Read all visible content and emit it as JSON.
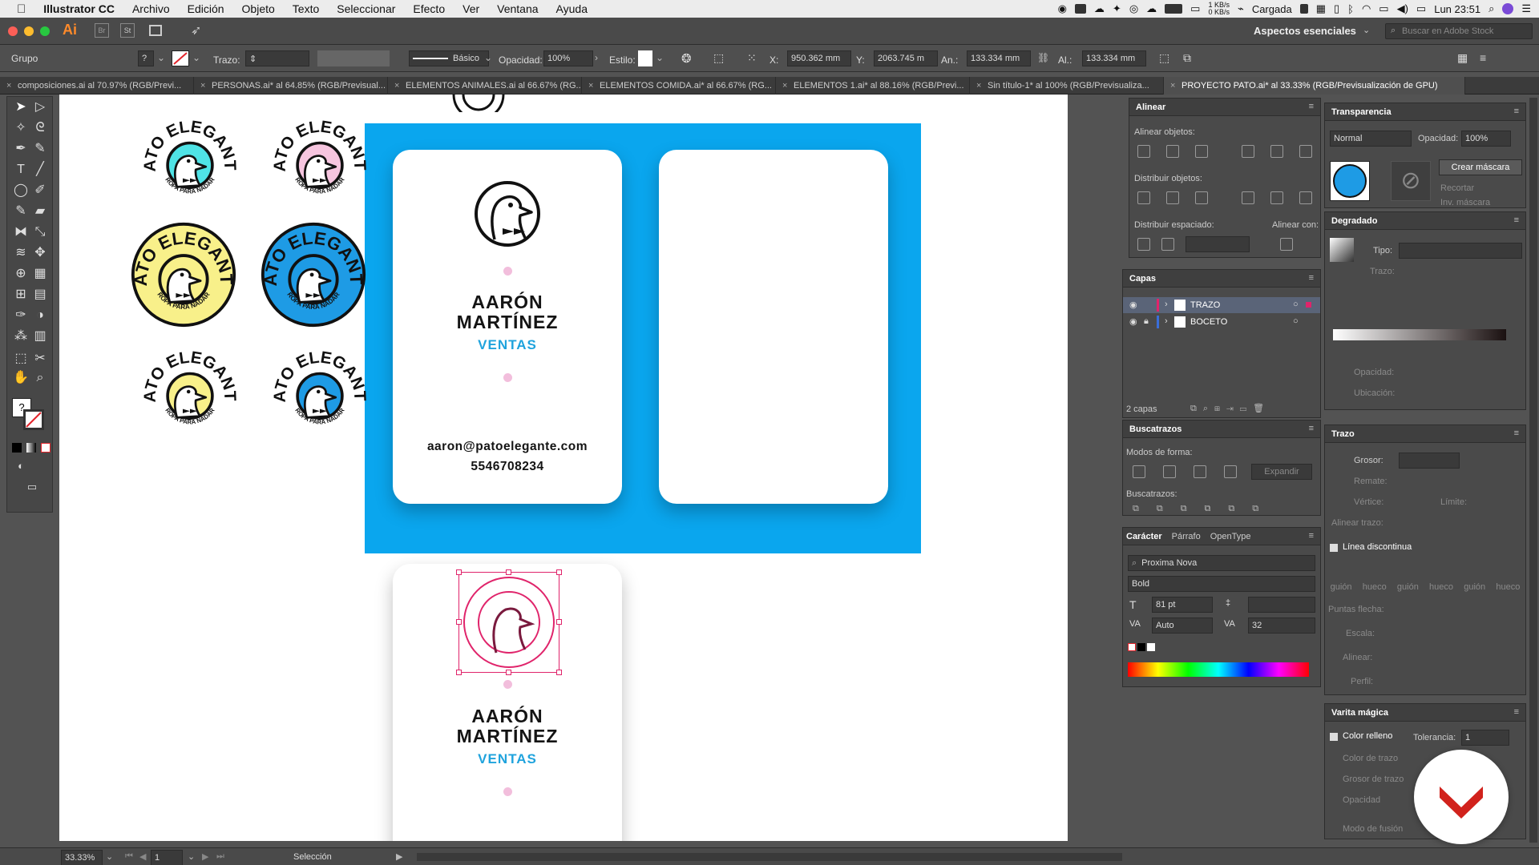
{
  "menubar": {
    "app_name": "Illustrator CC",
    "items": [
      "Archivo",
      "Edición",
      "Objeto",
      "Texto",
      "Seleccionar",
      "Efecto",
      "Ver",
      "Ventana",
      "Ayuda"
    ],
    "net_up": "1 KB/s",
    "net_down": "0 KB/s",
    "battery_label": "Cargada",
    "clock": "Lun 23:51"
  },
  "appbar": {
    "logo": "Ai",
    "workspace": "Aspectos esenciales",
    "search_placeholder": "Buscar en Adobe Stock"
  },
  "control": {
    "selection_type": "Grupo",
    "stroke_label": "Trazo:",
    "brush_label": "Básico",
    "opacity_label": "Opacidad:",
    "opacity_value": "100%",
    "style_label": "Estilo:",
    "x_label": "X:",
    "x_value": "950.362 mm",
    "y_label": "Y:",
    "y_value": "2063.745 m",
    "w_label": "An.:",
    "w_value": "133.334 mm",
    "h_label": "Al.:",
    "h_value": "133.334 mm"
  },
  "tabs": [
    "composiciones.ai al 70.97% (RGB/Previ...",
    "PERSONAS.ai* al 64.85% (RGB/Previsual...",
    "ELEMENTOS ANIMALES.ai al 66.67% (RG...",
    "ELEMENTOS COMIDA.ai* al 66.67% (RG...",
    "ELEMENTOS 1.ai* al 88.16% (RGB/Previ...",
    "Sin título-1* al 100% (RGB/Previsualiza...",
    "PROYECTO PATO.ai* al 33.33% (RGB/Previsualización de GPU)"
  ],
  "logos": {
    "top_text": "PATO ELEGANTE",
    "bottom_text": "ROPA PARA NADAR",
    "colors": [
      "#4fe3e6",
      "#f6c5df",
      "#f8f08a",
      "#1e9be5",
      "#f8f08a",
      "#1e9be5"
    ]
  },
  "card": {
    "name_line1": "AARÓN",
    "name_line2": "MARTÍNEZ",
    "role": "VENTAS",
    "email": "aaron@patoelegante.com",
    "phone": "5546708234",
    "bg_color": "#0aa6ee",
    "accent": "#1fa3dd",
    "dot_color": "#f2bedc"
  },
  "panels": {
    "align": {
      "title": "Alinear",
      "align_objects": "Alinear objetos:",
      "distribute_objects": "Distribuir objetos:",
      "distribute_spacing": "Distribuir espaciado:",
      "align_to": "Alinear con:"
    },
    "layers": {
      "title": "Capas",
      "items": [
        "TRAZO",
        "BOCETO"
      ],
      "count": "2 capas"
    },
    "pathfinder": {
      "title": "Buscatrazos",
      "shape_modes": "Modos de forma:",
      "expand": "Expandir",
      "pathfinders": "Buscatrazos:"
    },
    "character": {
      "tabs": [
        "Carácter",
        "Párrafo",
        "OpenType"
      ],
      "font": "Proxima Nova",
      "style": "Bold",
      "size": "81 pt",
      "leading": "Auto",
      "tracking": "32"
    },
    "transparency": {
      "title": "Transparencia",
      "mode": "Normal",
      "opacity_label": "Opacidad:",
      "opacity": "100%",
      "make_mask": "Crear máscara",
      "clip": "Recortar",
      "invert": "Inv. máscara"
    },
    "gradient": {
      "title": "Degradado",
      "type_label": "Tipo:",
      "stroke_label": "Trazo:",
      "opacity_label": "Opacidad:",
      "location_label": "Ubicación:"
    },
    "stroke": {
      "title": "Trazo",
      "weight_label": "Grosor:",
      "cap_label": "Remate:",
      "corner_label": "Vértice:",
      "limit_label": "Límite:",
      "align_label": "Alinear trazo:",
      "dashed_label": "Línea discontinua",
      "dash_labels": [
        "guión",
        "hueco",
        "guión",
        "hueco",
        "guión",
        "hueco"
      ],
      "arrow_label": "Puntas flecha:",
      "scale_label": "Escala:",
      "align2_label": "Alinear:",
      "profile_label": "Perfil:"
    },
    "magic_wand": {
      "title": "Varita mágica",
      "fill_label": "Color relleno",
      "tolerance_label": "Tolerancia:",
      "tolerance": "1",
      "stroke_color": "Color de trazo",
      "stroke_weight": "Grosor de trazo",
      "opacity": "Opacidad",
      "blend": "Modo de fusión"
    }
  },
  "status": {
    "zoom": "33.33%",
    "page": "1",
    "tool": "Selección"
  }
}
